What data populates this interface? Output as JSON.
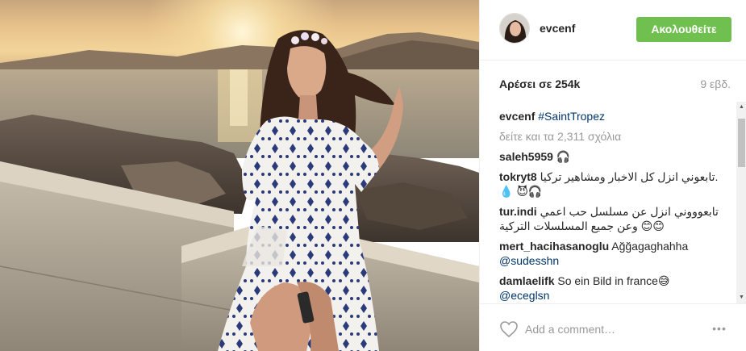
{
  "post": {
    "username": "evcenf",
    "follow_label": "Ακολουθείτε",
    "likes": "Αρέσει σε 254k",
    "time_ago": "9 εβδ.",
    "caption_user": "evcenf",
    "caption_tag": "#SaintTropez",
    "load_more": "δείτε και τα 2,311 σχόλια"
  },
  "comments": [
    {
      "user": "saleh5959",
      "text": " 🎧"
    },
    {
      "user": "tokryt8",
      "text": " تابعوني انزل كل الاخبار ومشاهير تركيا.💧 😈🎧"
    },
    {
      "user": "tur.indi",
      "text": " تابعوووني انزل عن مسلسل حب اعمي وعن جميع المسلسلات التركية 😊😊"
    },
    {
      "user": "mert_hacihasanoglu",
      "text": " Ağğagaghahha",
      "mention": "@sudesshn"
    },
    {
      "user": "damlaelifk",
      "text": " So ein Bild in france😅",
      "mention": "@eceglsn"
    }
  ],
  "footer": {
    "comment_placeholder": "Add a comment…",
    "more_label": "•••"
  },
  "icons": {
    "avatar": "user-avatar",
    "like": "heart-icon",
    "more": "more-options-icon"
  },
  "colors": {
    "follow_button": "#70c050",
    "hashtag": "#003569",
    "muted": "#999999"
  }
}
